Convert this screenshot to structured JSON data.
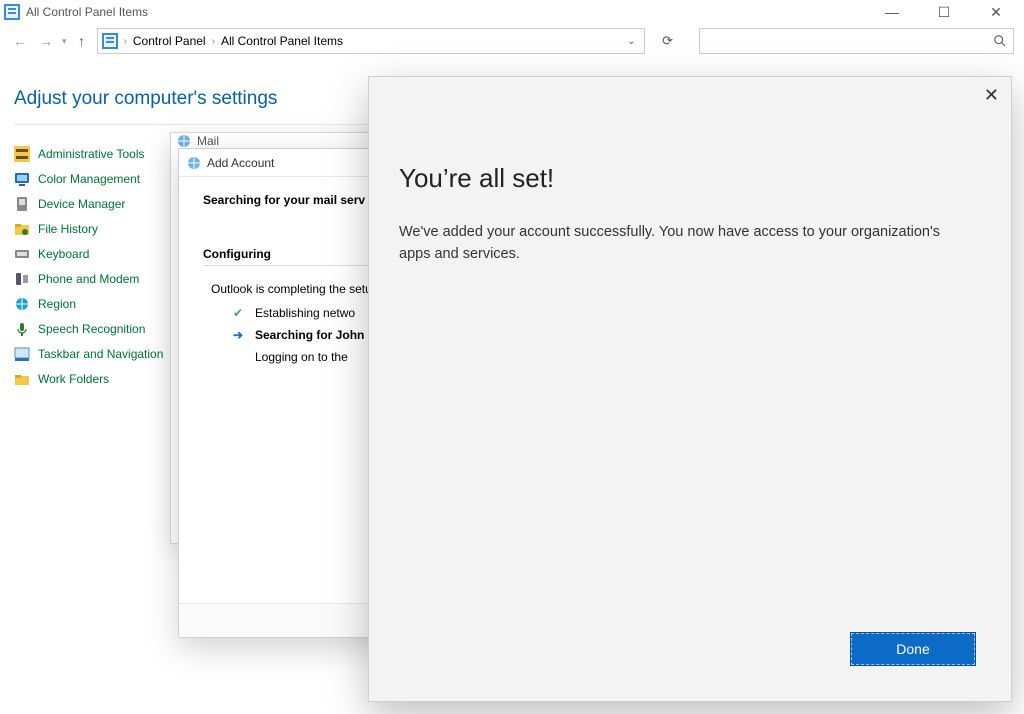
{
  "window": {
    "title": "All Control Panel Items"
  },
  "breadcrumb": {
    "root": "Control Panel",
    "current": "All Control Panel Items"
  },
  "search": {
    "placeholder": ""
  },
  "heading": "Adjust your computer's settings",
  "cp_items": [
    "Administrative Tools",
    "Color Management",
    "Device Manager",
    "File History",
    "Keyboard",
    "Phone and Modem",
    "Region",
    "Speech Recognition",
    "Taskbar and Navigation",
    "Work Folders"
  ],
  "mail": {
    "title": "Mail"
  },
  "add_account": {
    "title": "Add Account",
    "heading": "Searching for your mail serv",
    "subhead": "Configuring",
    "intro": "Outlook is completing the setu",
    "steps": {
      "done": "Establishing netwo",
      "active": "Searching for John",
      "pending": "Logging on to the"
    }
  },
  "allset": {
    "title": "You’re all set!",
    "body": "We've added your account successfully. You now have access to your organization's apps and services.",
    "done_label": "Done"
  }
}
